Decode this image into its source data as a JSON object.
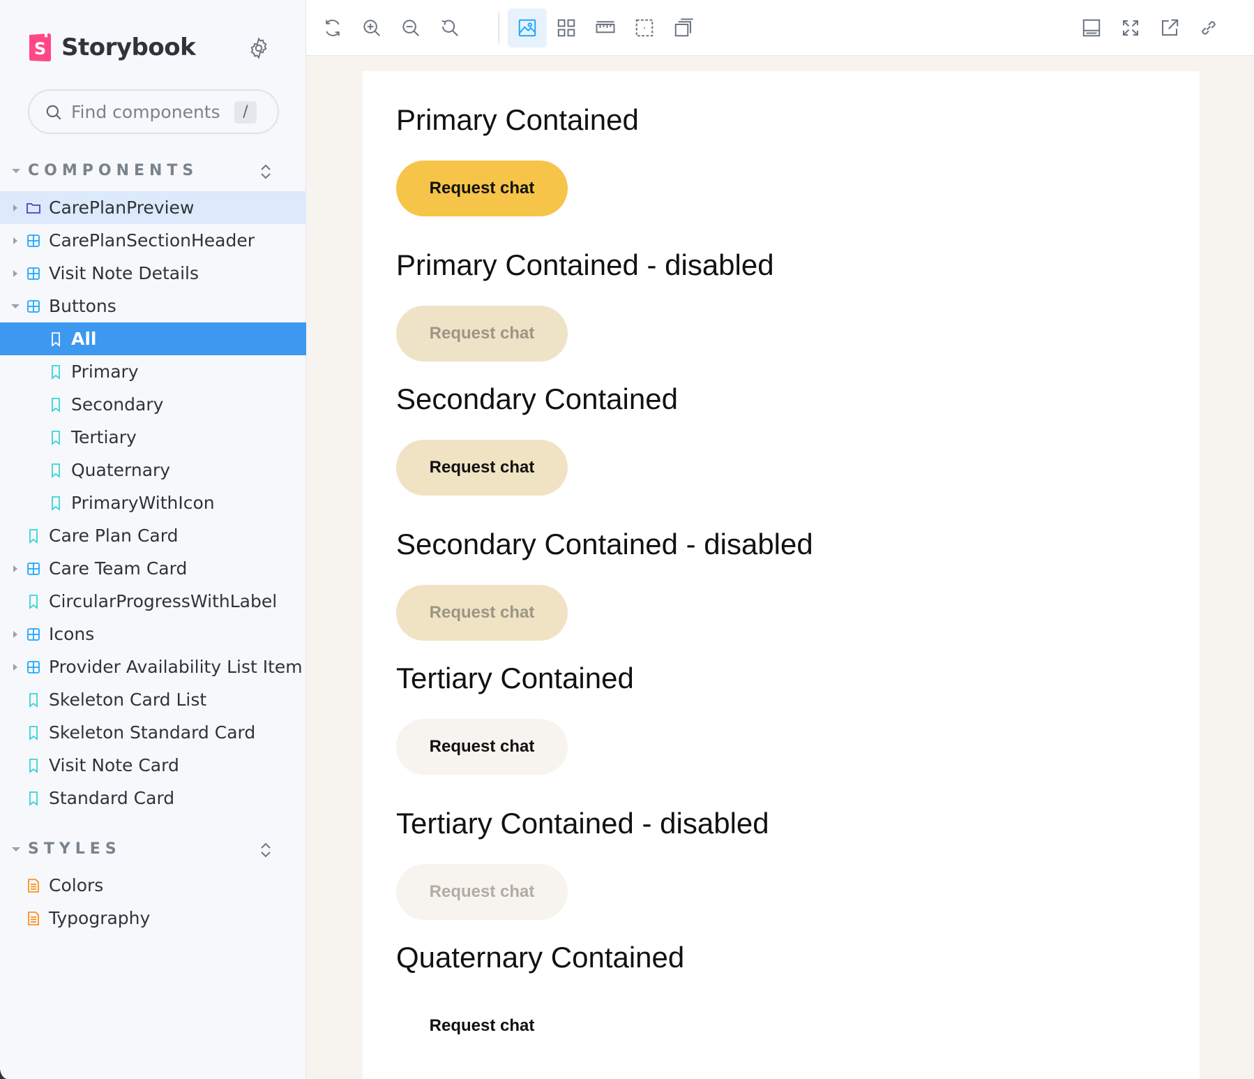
{
  "sidebar": {
    "brand": "Storybook",
    "search": {
      "placeholder": "Find components",
      "shortcut": "/"
    },
    "sections": [
      {
        "label": "COMPONENTS"
      },
      {
        "label": "STYLES"
      }
    ],
    "items": [
      {
        "label": "CarePlanPreview",
        "type": "folder"
      },
      {
        "label": "CarePlanSectionHeader",
        "type": "component"
      },
      {
        "label": "Visit Note Details",
        "type": "component"
      },
      {
        "label": "Buttons",
        "type": "component"
      },
      {
        "label": "All",
        "type": "story"
      },
      {
        "label": "Primary",
        "type": "story"
      },
      {
        "label": "Secondary",
        "type": "story"
      },
      {
        "label": "Tertiary",
        "type": "story"
      },
      {
        "label": "Quaternary",
        "type": "story"
      },
      {
        "label": "PrimaryWithIcon",
        "type": "story"
      },
      {
        "label": "Care Plan Card",
        "type": "story"
      },
      {
        "label": "Care Team Card",
        "type": "component"
      },
      {
        "label": "CircularProgressWithLabel",
        "type": "story"
      },
      {
        "label": "Icons",
        "type": "component"
      },
      {
        "label": "Provider Availability List Item",
        "type": "component"
      },
      {
        "label": "Skeleton Card List",
        "type": "story"
      },
      {
        "label": "Skeleton Standard Card",
        "type": "story"
      },
      {
        "label": "Visit Note Card",
        "type": "story"
      },
      {
        "label": "Standard Card",
        "type": "story"
      },
      {
        "label": "Colors",
        "type": "doc"
      },
      {
        "label": "Typography",
        "type": "doc"
      }
    ]
  },
  "toolbar": {
    "left": [
      "reload-icon",
      "zoom-in-icon",
      "zoom-out-icon",
      "reset-zoom-icon",
      "background-icon",
      "grid-icon",
      "measure-icon",
      "outline-icon",
      "viewport-icon"
    ],
    "right": [
      "addons-panel-icon",
      "fullscreen-icon",
      "open-new-tab-icon",
      "copy-link-icon"
    ]
  },
  "stories": [
    {
      "title": "Primary Contained",
      "button": "Request chat",
      "variant": "primary"
    },
    {
      "title": "Primary Contained - disabled",
      "button": "Request chat",
      "variant": "primary-disabled"
    },
    {
      "title": "Secondary Contained",
      "button": "Request chat",
      "variant": "secondary"
    },
    {
      "title": "Secondary Contained - disabled",
      "button": "Request chat",
      "variant": "secondary-disabled"
    },
    {
      "title": "Tertiary Contained",
      "button": "Request chat",
      "variant": "tertiary"
    },
    {
      "title": "Tertiary Contained - disabled",
      "button": "Request chat",
      "variant": "tertiary-disabled"
    },
    {
      "title": "Quaternary Contained",
      "button": "Request chat",
      "variant": "quaternary"
    }
  ],
  "colors": {
    "accent": "#3d98f0",
    "primary_button": "#f6c448",
    "secondary_button": "#f0e3c4",
    "tertiary_button": "#f7f3ee",
    "brand_logo": "#ff4785"
  }
}
